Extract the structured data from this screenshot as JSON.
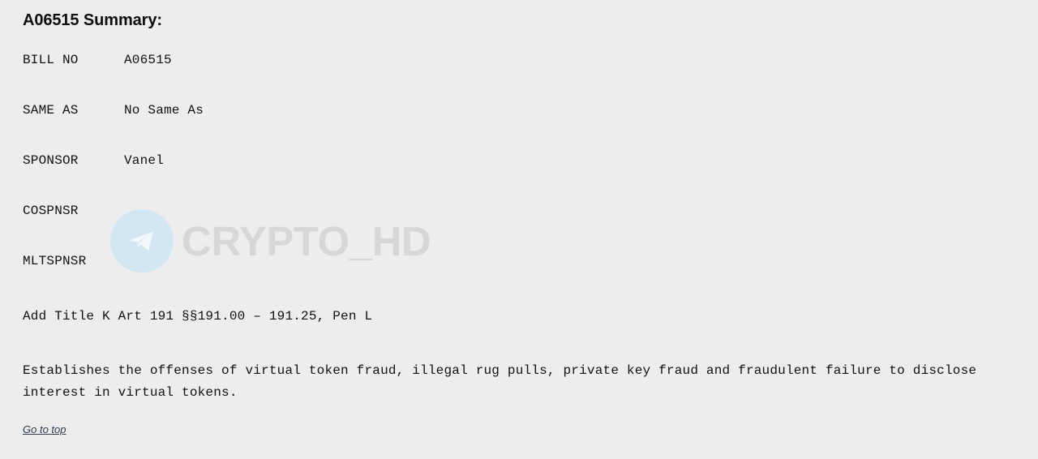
{
  "page": {
    "title": "A06515 Summary:",
    "background_color": "#ededed",
    "text_color": "#111111"
  },
  "summary": {
    "rows": [
      {
        "label": "BILL NO",
        "value": "A06515"
      },
      {
        "label": "SAME AS",
        "value": "No Same As"
      },
      {
        "label": "SPONSOR",
        "value": "Vanel"
      },
      {
        "label": "COSPNSR",
        "value": ""
      },
      {
        "label": "MLTSPNSR",
        "value": ""
      }
    ]
  },
  "amendment": {
    "text": "Add Title K Art 191 §§191.00 – 191.25, Pen L"
  },
  "description": {
    "text": "Establishes the offenses of virtual token fraud, illegal rug pulls, private key fraud and fraudulent failure to disclose interest in virtual tokens."
  },
  "footer": {
    "go_to_top_label": "Go to top",
    "link_color": "#2f3d4f"
  },
  "watermark": {
    "icon": "telegram-paper-plane-icon",
    "text": "CRYPTO_HD",
    "text_color": "#d7d7d7",
    "circle_color": "#d3e7f2"
  }
}
